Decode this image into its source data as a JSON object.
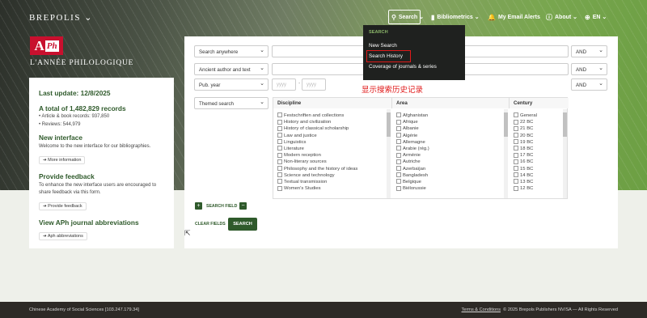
{
  "nav": {
    "brand": "BREPOLIS",
    "search": "Search",
    "bibliometrics": "Bibliometrics",
    "email_alerts": "My Email Alerts",
    "about": "About",
    "lang": "EN"
  },
  "logo": {
    "mark": "A",
    "mark_small": "Ph",
    "text": "L'ANNÉE PHILOLOGIQUE"
  },
  "sidebar": {
    "last_update": "Last update: 12/8/2025",
    "total": "A total of 1,482,829 records",
    "records": [
      "Article & book records: 937,850",
      "Reviews: 544,979"
    ],
    "new_title": "New interface",
    "new_text": "Welcome to the new interface for our bibliographies.",
    "more_info": "➔ More information",
    "feedback_title": "Provide feedback",
    "feedback_text": "To enhance the new interface users are encouraged to share feedback via this form.",
    "feedback_btn": "➔ Provide feedback",
    "abbrev_title": "View APh journal abbreviations",
    "abbrev_btn": "➔ Aph abbreviations"
  },
  "form": {
    "row1_field": "Search anywhere",
    "row2_field": "Ancient author and text",
    "row3_field": "Pub. year",
    "op": "AND",
    "year_from": "yyyy",
    "year_to": "yyyy",
    "dash": "-",
    "themed": "Themed search",
    "columns": [
      "Discipline",
      "Area",
      "Century"
    ],
    "disciplines": [
      "Festschriften and collections",
      "History and civilization",
      "History of classical scholarship",
      "Law and justice",
      "Linguistics",
      "Literature",
      "Modern reception",
      "Non-literary sources",
      "Philosophy and the history of ideas",
      "Science and technology",
      "Textual transmission",
      "Women's Studies"
    ],
    "areas": [
      "Afghanistan",
      "Afrique",
      "Albanie",
      "Algérie",
      "Allemagne",
      "Arabie (rég.)",
      "Arménie",
      "Autriche",
      "Azerbaïjan",
      "Bangladesh",
      "Belgique",
      "Biélorussie"
    ],
    "centuries": [
      "General",
      "22 BC",
      "21 BC",
      "20 BC",
      "19 BC",
      "18 BC",
      "17 BC",
      "16 BC",
      "15 BC",
      "14 BC",
      "13 BC",
      "12 BC"
    ],
    "search_field": "SEARCH FIELD",
    "clear": "CLEAR FIELDS",
    "search_btn": "SEARCH"
  },
  "dropdown": {
    "heading": "SEARCH",
    "items": [
      "New Search",
      "Search History",
      "Coverage of journals & series"
    ]
  },
  "annotation": "显示搜索历史记录",
  "footer": {
    "left": "Chinese Academy of Social Sciences [103.247.179.34]",
    "terms": "Terms & Conditions",
    "right": "© 2025 Brepols Publishers NV/SA — All Rights Reserved"
  },
  "colors": {
    "accent": "#2f5a2b",
    "highlight": "#e01a1a"
  }
}
